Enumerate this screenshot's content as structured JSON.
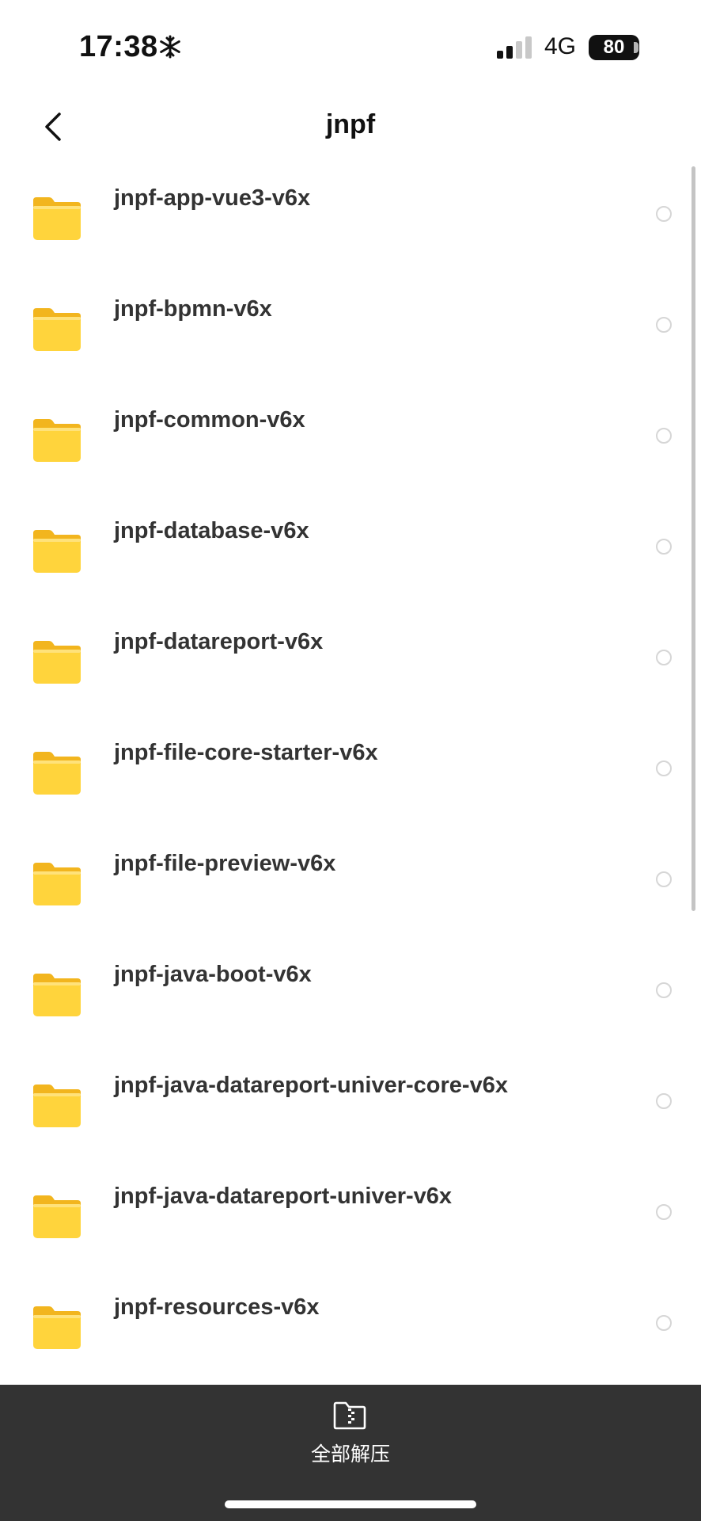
{
  "status_bar": {
    "time": "17:38",
    "network": "4G",
    "battery": "80"
  },
  "nav": {
    "title": "jnpf"
  },
  "files": [
    {
      "name": "jnpf-app-vue3-v6x"
    },
    {
      "name": "jnpf-bpmn-v6x"
    },
    {
      "name": "jnpf-common-v6x"
    },
    {
      "name": "jnpf-database-v6x"
    },
    {
      "name": "jnpf-datareport-v6x"
    },
    {
      "name": "jnpf-file-core-starter-v6x"
    },
    {
      "name": "jnpf-file-preview-v6x"
    },
    {
      "name": "jnpf-java-boot-v6x"
    },
    {
      "name": "jnpf-java-datareport-univer-core-v6x"
    },
    {
      "name": "jnpf-java-datareport-univer-v6x"
    },
    {
      "name": "jnpf-resources-v6x"
    }
  ],
  "bottom_bar": {
    "extract_all_label": "全部解压"
  },
  "icons": {
    "folder": "folder-icon",
    "back": "chevron-left-icon",
    "zip": "zip-file-icon",
    "status": "snowflake-icon"
  },
  "colors": {
    "folder_yellow": "#FFD43C",
    "bottom_bar": "#333333",
    "text_primary": "#333333"
  }
}
